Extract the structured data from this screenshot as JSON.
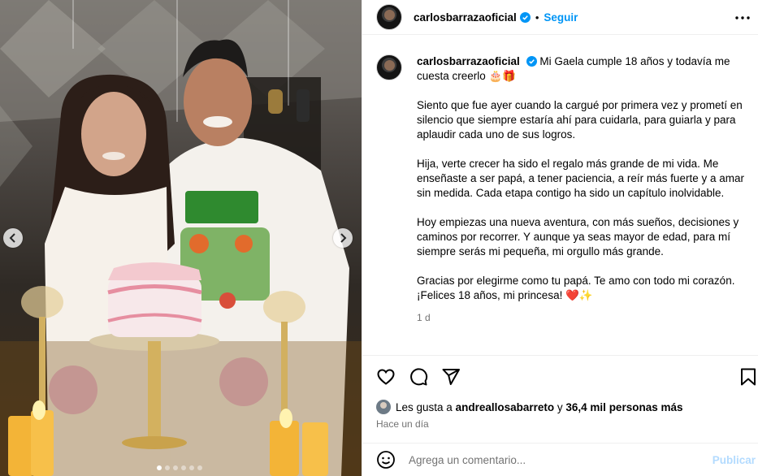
{
  "post": {
    "author": "carlosbarrazaoficial",
    "follow_label": "Seguir",
    "separator": "•",
    "caption_intro": "Mi Gaela cumple 18 años y todavía me cuesta creerlo 🎂🎁",
    "paragraphs": [
      "Siento que fue ayer cuando la cargué por primera vez y prometí en silencio que siempre estaría ahí para cuidarla, para guiarla y para aplaudir cada uno de sus logros.",
      "Hija, verte crecer ha sido el regalo más grande de mi vida. Me enseñaste a ser papá, a tener paciencia, a reír más fuerte y a amar sin medida. Cada etapa contigo ha sido un capítulo inolvidable.",
      "Hoy empiezas una nueva aventura, con más sueños, decisiones y caminos por recorrer. Y aunque ya seas mayor de edad, para mí siempre serás mi pequeña, mi orgullo más grande.",
      "Gracias por elegirme como tu papá. Te amo con todo mi corazón. ¡Felices 18 años, mi princesa! ❤️✨"
    ],
    "caption_age": "1 d",
    "likes_prefix": "Les gusta a",
    "likes_user": "andreallosabarreto",
    "likes_joiner": "y",
    "likes_others": "36,4 mil personas más",
    "posted_time": "Hace un día",
    "comment_placeholder": "Agrega un comentario...",
    "publish_label": "Publicar"
  },
  "carousel": {
    "total": 6,
    "active_index": 0
  },
  "icons": {
    "verified": "verified-badge-icon",
    "more": "more-options-icon",
    "like": "heart-icon",
    "comment": "comment-icon",
    "share": "share-icon",
    "save": "bookmark-icon",
    "emoji": "emoji-icon",
    "prev": "chevron-left-icon",
    "next": "chevron-right-icon"
  },
  "colors": {
    "accent": "#0095f6",
    "verified": "#0095f6",
    "publish_disabled": "#b3dbff",
    "secondary_text": "#737373"
  }
}
